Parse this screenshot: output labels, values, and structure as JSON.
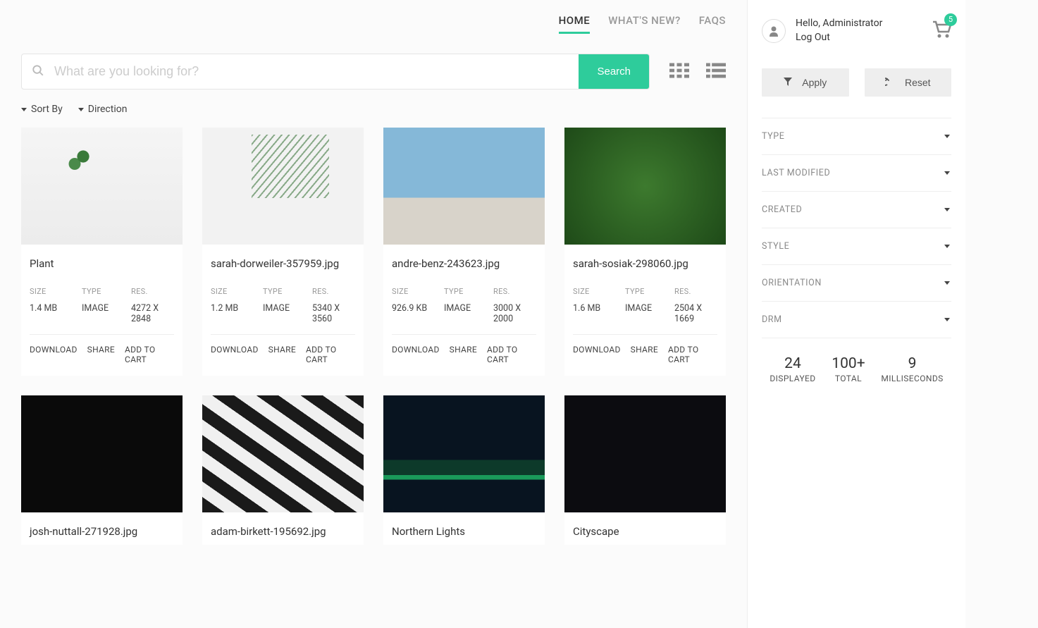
{
  "nav": {
    "home": "HOME",
    "whatsnew": "WHAT'S NEW?",
    "faqs": "FAQS"
  },
  "search": {
    "placeholder": "What are you looking for?",
    "button": "Search"
  },
  "sort": {
    "sortby": "Sort By",
    "direction": "Direction"
  },
  "user": {
    "greeting": "Hello, Administrator",
    "logout": "Log Out",
    "cart_count": "5"
  },
  "filters": {
    "apply": "Apply",
    "reset": "Reset",
    "sections": [
      "TYPE",
      "LAST MODIFIED",
      "CREATED",
      "STYLE",
      "ORIENTATION",
      "DRM"
    ]
  },
  "stats": {
    "displayed_n": "24",
    "displayed_l": "DISPLAYED",
    "total_n": "100+",
    "total_l": "TOTAL",
    "ms_n": "9",
    "ms_l": "MILLISECONDS"
  },
  "meta_labels": {
    "size": "SIZE",
    "type": "TYPE",
    "res": "RES."
  },
  "actions": {
    "download": "DOWNLOAD",
    "share": "SHARE",
    "add": "ADD TO CART"
  },
  "items": [
    {
      "title": "Plant",
      "size": "1.4 MB",
      "type": "IMAGE",
      "res": "4272 X 2848",
      "thumb": "th-plant1"
    },
    {
      "title": "sarah-dorweiler-357959.jpg",
      "size": "1.2 MB",
      "type": "IMAGE",
      "res": "5340 X 3560",
      "thumb": "th-plant2"
    },
    {
      "title": "andre-benz-243623.jpg",
      "size": "926.9 KB",
      "type": "IMAGE",
      "res": "3000 X 2000",
      "thumb": "th-building"
    },
    {
      "title": "sarah-sosiak-298060.jpg",
      "size": "1.6 MB",
      "type": "IMAGE",
      "res": "2504 X 1669",
      "thumb": "th-leaf"
    },
    {
      "title": "josh-nuttall-271928.jpg",
      "thumb": "th-bike"
    },
    {
      "title": "adam-birkett-195692.jpg",
      "thumb": "th-stripes"
    },
    {
      "title": "Northern Lights",
      "thumb": "th-aurora"
    },
    {
      "title": "Cityscape",
      "thumb": "th-city"
    }
  ]
}
